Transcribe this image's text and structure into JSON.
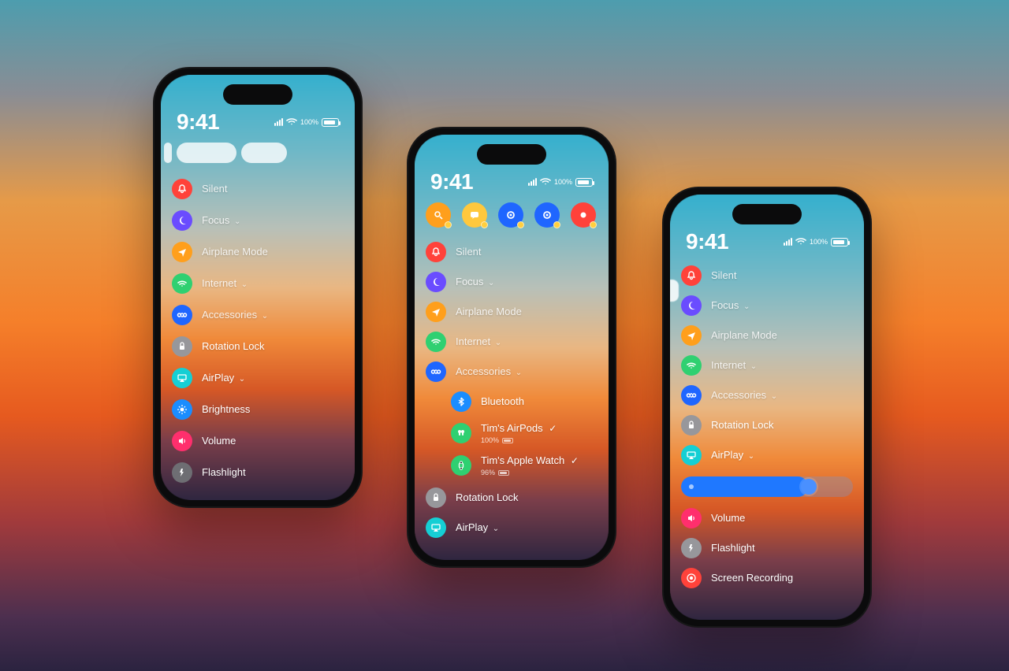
{
  "status": {
    "time": "9:41",
    "pct": "100%"
  },
  "phone1": {
    "items": [
      {
        "label": "Silent",
        "color": "c-red",
        "glyph": "bell"
      },
      {
        "label": "Focus",
        "color": "c-purple",
        "glyph": "moon",
        "chev": true
      },
      {
        "label": "Airplane Mode",
        "color": "c-orange",
        "glyph": "plane"
      },
      {
        "label": "Internet",
        "color": "c-green",
        "glyph": "wifi",
        "chev": true
      },
      {
        "label": "Accessories",
        "color": "c-blue",
        "glyph": "link",
        "chev": true
      },
      {
        "label": "Rotation Lock",
        "color": "c-gray",
        "glyph": "lock"
      },
      {
        "label": "AirPlay",
        "color": "c-cyan",
        "glyph": "airplay",
        "chev": true
      },
      {
        "label": "Brightness",
        "color": "c-lblue",
        "glyph": "sun"
      },
      {
        "label": "Volume",
        "color": "c-pink",
        "glyph": "vol"
      },
      {
        "label": "Flashlight",
        "color": "c-dgray",
        "glyph": "flash"
      }
    ]
  },
  "phone2": {
    "quick": [
      {
        "color": "c-orange",
        "glyph": "search"
      },
      {
        "color": "c-yellow",
        "glyph": "chat"
      },
      {
        "color": "c-blue",
        "glyph": "target"
      },
      {
        "color": "c-blue",
        "glyph": "target"
      },
      {
        "color": "c-red",
        "glyph": "dot"
      }
    ],
    "items": [
      {
        "label": "Silent",
        "color": "c-red",
        "glyph": "bell"
      },
      {
        "label": "Focus",
        "color": "c-purple",
        "glyph": "moon",
        "chev": true
      },
      {
        "label": "Airplane Mode",
        "color": "c-orange",
        "glyph": "plane"
      },
      {
        "label": "Internet",
        "color": "c-green",
        "glyph": "wifi",
        "chev": true
      },
      {
        "label": "Accessories",
        "color": "c-blue",
        "glyph": "link",
        "chev": true
      }
    ],
    "sub": [
      {
        "label": "Bluetooth",
        "color": "c-lblue",
        "glyph": "bt"
      },
      {
        "label": "Tim's AirPods",
        "color": "c-green",
        "glyph": "pods",
        "check": true,
        "pct": "100%"
      },
      {
        "label": "Tim's Apple Watch",
        "color": "c-green",
        "glyph": "watch",
        "check": true,
        "pct": "96%"
      }
    ],
    "tail": [
      {
        "label": "Rotation Lock",
        "color": "c-gray",
        "glyph": "lock"
      },
      {
        "label": "AirPlay",
        "color": "c-cyan",
        "glyph": "airplay",
        "chev": true
      }
    ]
  },
  "phone3": {
    "items": [
      {
        "label": "Silent",
        "color": "c-red",
        "glyph": "bell"
      },
      {
        "label": "Focus",
        "color": "c-purple",
        "glyph": "moon",
        "chev": true
      },
      {
        "label": "Airplane Mode",
        "color": "c-orange",
        "glyph": "plane"
      },
      {
        "label": "Internet",
        "color": "c-green",
        "glyph": "wifi",
        "chev": true
      },
      {
        "label": "Accessories",
        "color": "c-blue",
        "glyph": "link",
        "chev": true
      },
      {
        "label": "Rotation Lock",
        "color": "c-gray",
        "glyph": "lock"
      },
      {
        "label": "AirPlay",
        "color": "c-cyan",
        "glyph": "airplay",
        "chev": true
      }
    ],
    "tail": [
      {
        "label": "Volume",
        "color": "c-pink",
        "glyph": "vol"
      },
      {
        "label": "Flashlight",
        "color": "c-gray",
        "glyph": "flash"
      },
      {
        "label": "Screen Recording",
        "color": "c-red",
        "glyph": "rec"
      }
    ],
    "brightness_pct": 74
  }
}
